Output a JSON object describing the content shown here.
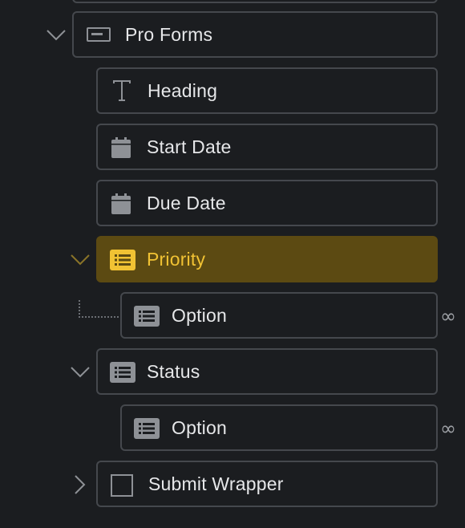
{
  "tree": {
    "pro_forms": {
      "label": "Pro Forms",
      "icon": "form-icon",
      "expanded": true
    },
    "heading": {
      "label": "Heading",
      "icon": "text-icon"
    },
    "start_date": {
      "label": "Start Date",
      "icon": "calendar-icon"
    },
    "due_date": {
      "label": "Due Date",
      "icon": "calendar-icon"
    },
    "priority": {
      "label": "Priority",
      "icon": "list-icon",
      "expanded": true,
      "selected": true
    },
    "priority_option": {
      "label": "Option",
      "icon": "list-icon",
      "suffix": "∞"
    },
    "status": {
      "label": "Status",
      "icon": "list-icon",
      "expanded": true
    },
    "status_option": {
      "label": "Option",
      "icon": "list-icon",
      "suffix": "∞"
    },
    "submit_wrapper": {
      "label": "Submit Wrapper",
      "icon": "checkbox-icon",
      "expanded": false
    }
  },
  "colors": {
    "background": "#1b1d20",
    "border": "#45484d",
    "text": "#e6e7e9",
    "icon": "#8e9196",
    "selected_bg": "#5c4a12",
    "selected_text": "#f1c233"
  }
}
